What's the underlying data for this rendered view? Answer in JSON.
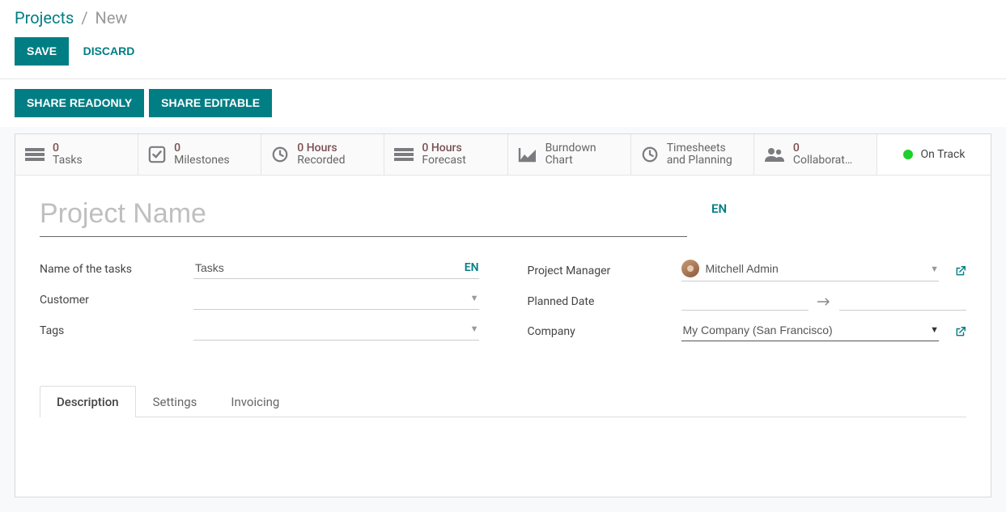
{
  "breadcrumb": {
    "root": "Projects",
    "sep": "/",
    "current": "New"
  },
  "actions": {
    "save": "SAVE",
    "discard": "DISCARD",
    "share_readonly": "SHARE READONLY",
    "share_editable": "SHARE EDITABLE"
  },
  "stats": {
    "tasks_count": "0",
    "tasks_label": "Tasks",
    "milestones_count": "0",
    "milestones_label": "Milestones",
    "recorded_count": "0 Hours",
    "recorded_label": "Recorded",
    "forecast_count": "0 Hours",
    "forecast_label": "Forecast",
    "burndown_label": "Burndown Chart",
    "timesheets_label": "Timesheets and Planning",
    "collab_count": "0",
    "collab_label": "Collaborat…",
    "status_label": "On Track"
  },
  "title": {
    "placeholder": "Project Name",
    "lang": "EN"
  },
  "fields": {
    "name_of_tasks_label": "Name of the tasks",
    "name_of_tasks_value": "Tasks",
    "name_of_tasks_lang": "EN",
    "customer_label": "Customer",
    "tags_label": "Tags",
    "project_manager_label": "Project Manager",
    "project_manager_value": "Mitchell Admin",
    "planned_date_label": "Planned Date",
    "company_label": "Company",
    "company_value": "My Company (San Francisco)"
  },
  "tabs": {
    "description": "Description",
    "settings": "Settings",
    "invoicing": "Invoicing"
  }
}
